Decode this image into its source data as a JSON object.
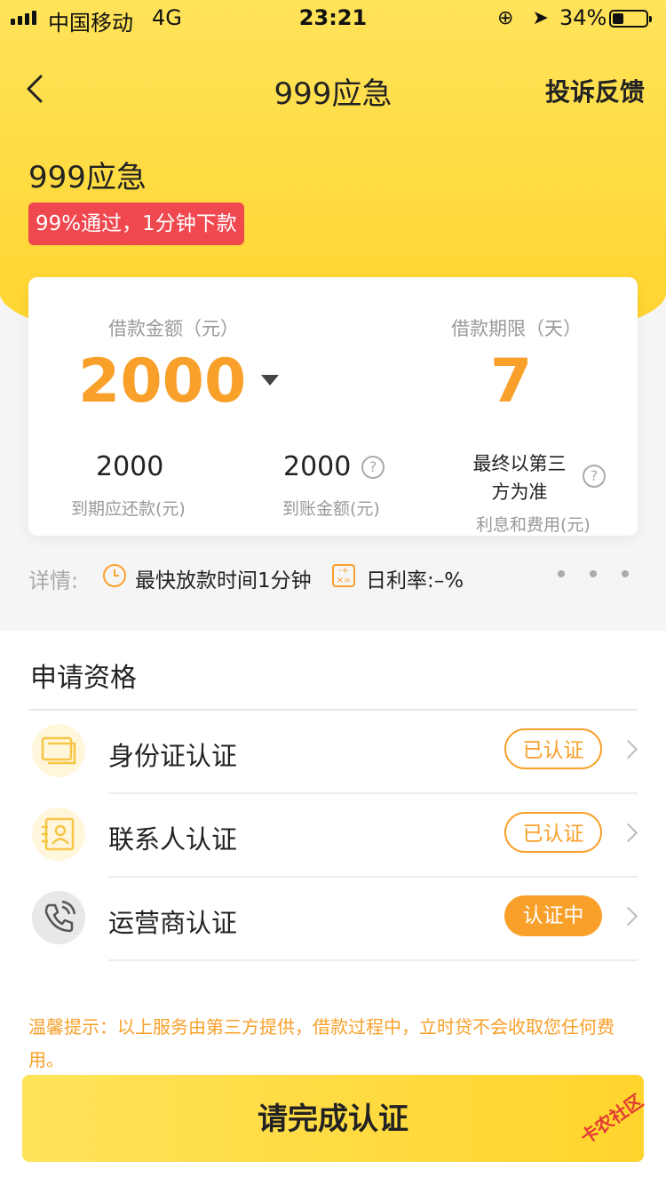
{
  "status_bar": {
    "carrier": "中国移动",
    "network": "4G",
    "time": "23:21",
    "battery_pct": "34%",
    "battery_level": 0.34
  },
  "nav": {
    "title": "999应急",
    "action": "投诉反馈"
  },
  "app": {
    "name": "999应急",
    "promo": "99%通过，1分钟下款"
  },
  "loan_card": {
    "amount_label": "借款金额（元）",
    "amount": "2000",
    "term_label": "借款期限（天）",
    "term": "7",
    "repay_value": "2000",
    "repay_label": "到期应还款(元)",
    "received_value": "2000",
    "received_label": "到账金额(元)",
    "fee_note": "最终以第三方为准",
    "fee_label": "利息和费用(元)"
  },
  "details": {
    "label": "详情:",
    "fastest": "最快放款时间1分钟",
    "daily_rate": "日利率:–%"
  },
  "qualification": {
    "title": "申请资格",
    "items": [
      {
        "label": "身份证认证",
        "status": "已认证",
        "icon": "id-card-icon"
      },
      {
        "label": "联系人认证",
        "status": "已认证",
        "icon": "contact-card-icon"
      },
      {
        "label": "运营商认证",
        "status": "认证中",
        "icon": "phone-icon"
      }
    ]
  },
  "notice": "温馨提示：以上服务由第三方提供，借款过程中，立时贷不会收取您任何费用。",
  "cta": "请完成认证",
  "watermark": "卡农社区",
  "colors": {
    "accent": "#f9a02a",
    "brand_yellow": "#ffd42c",
    "promo_red": "#f0484f"
  }
}
